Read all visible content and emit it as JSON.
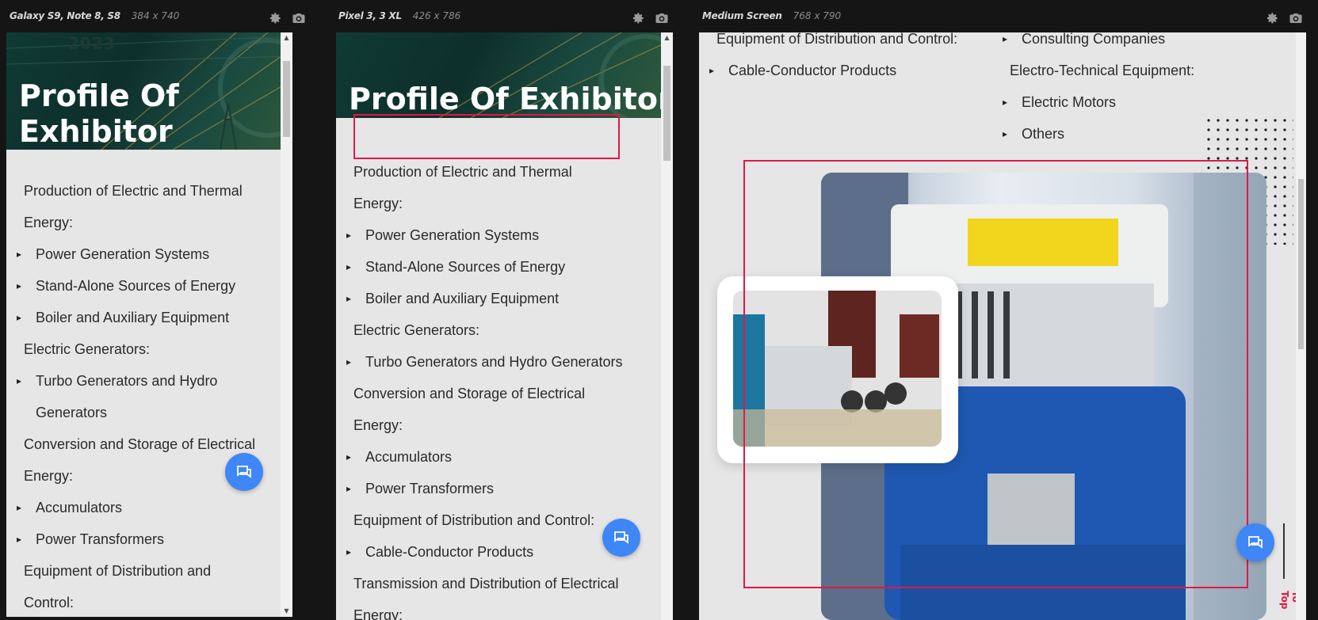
{
  "devices": [
    {
      "name": "Galaxy S9, Note 8, S8",
      "size": "384 x 740"
    },
    {
      "name": "Pixel 3, 3 XL",
      "size": "426 x 786"
    },
    {
      "name": "Medium Screen",
      "size": "768 x 790"
    }
  ],
  "hero": {
    "title": "Profile Of Exhibitor",
    "title_line1": "Profile Of",
    "title_line2": "Exhibitor",
    "year": "2023"
  },
  "list1": [
    {
      "type": "cat",
      "text": "Production of Electric and Thermal"
    },
    {
      "type": "cat",
      "text": "Energy:"
    },
    {
      "type": "item",
      "text": "Power Generation Systems"
    },
    {
      "type": "item",
      "text": "Stand-Alone Sources of Energy"
    },
    {
      "type": "item",
      "text": "Boiler and Auxiliary Equipment"
    },
    {
      "type": "cat",
      "text": "Electric Generators:"
    },
    {
      "type": "item",
      "text": "Turbo Generators and Hydro"
    },
    {
      "type": "cont",
      "text": "Generators"
    },
    {
      "type": "cat",
      "text": "Conversion and Storage of Electrical"
    },
    {
      "type": "cat",
      "text": "Energy:"
    },
    {
      "type": "item",
      "text": "Accumulators"
    },
    {
      "type": "item",
      "text": "Power Transformers"
    },
    {
      "type": "cat",
      "text": "Equipment of Distribution and"
    },
    {
      "type": "cat",
      "text": "Control:"
    }
  ],
  "list2": [
    {
      "type": "cat",
      "text": "Production of Electric and Thermal"
    },
    {
      "type": "cat",
      "text": "Energy:"
    },
    {
      "type": "item",
      "text": "Power Generation Systems"
    },
    {
      "type": "item",
      "text": "Stand-Alone Sources of Energy"
    },
    {
      "type": "item",
      "text": "Boiler and Auxiliary Equipment"
    },
    {
      "type": "cat",
      "text": "Electric Generators:"
    },
    {
      "type": "item",
      "text": "Turbo Generators and Hydro Generators"
    },
    {
      "type": "cat",
      "text": "Conversion and Storage of Electrical"
    },
    {
      "type": "cat",
      "text": "Energy:"
    },
    {
      "type": "item",
      "text": "Accumulators"
    },
    {
      "type": "item",
      "text": "Power Transformers"
    },
    {
      "type": "cat",
      "text": "Equipment of Distribution and Control:"
    },
    {
      "type": "item",
      "text": "Cable-Conductor Products"
    },
    {
      "type": "cat",
      "text": "Transmission and Distribution of Electrical"
    },
    {
      "type": "cat",
      "text": "Energy:"
    }
  ],
  "list3_left": [
    {
      "type": "cat",
      "text": "Equipment of Distribution and Control:"
    },
    {
      "type": "item",
      "text": "Cable-Conductor Products"
    }
  ],
  "list3_right": [
    {
      "type": "item",
      "text": "Consulting Companies"
    },
    {
      "type": "cat",
      "text": "Electro-Technical Equipment:"
    },
    {
      "type": "item",
      "text": "Electric Motors"
    },
    {
      "type": "item",
      "text": "Others"
    }
  ],
  "goto_top": "Go To Top",
  "colors": {
    "accent": "#3f86f6",
    "highlight": "#e21747",
    "page_bg": "#e6e6e6"
  }
}
